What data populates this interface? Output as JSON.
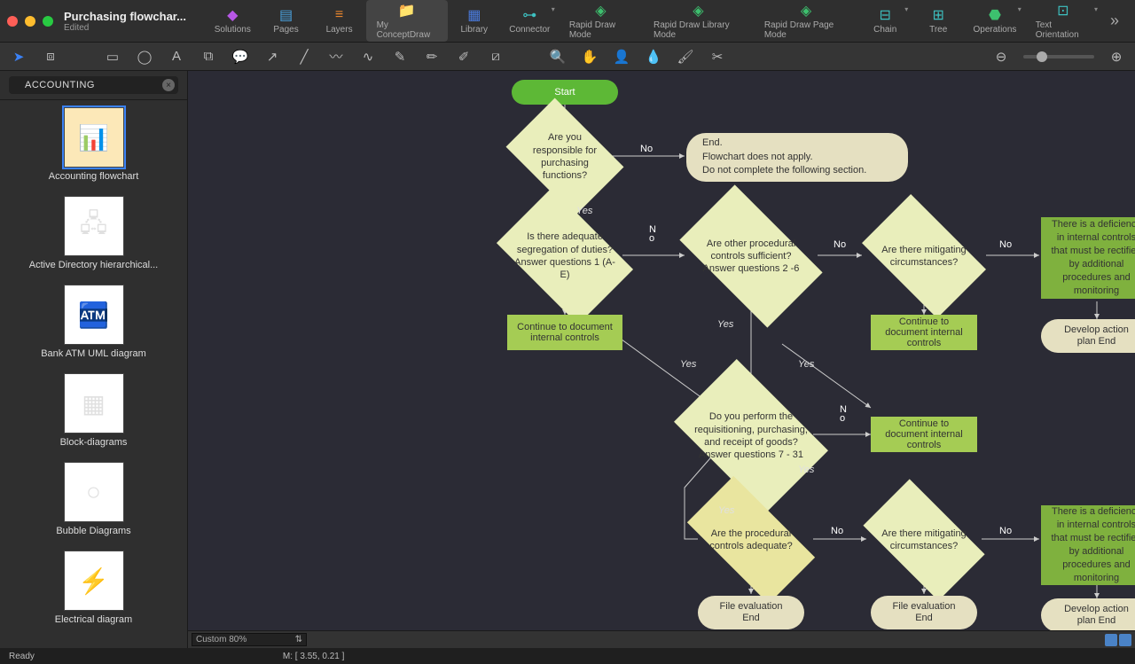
{
  "window": {
    "title": "Purchasing flowchar...",
    "subtitle": "Edited"
  },
  "toolbar": {
    "items": [
      {
        "label": "Solutions",
        "icon": "◆",
        "color": "#b757e6"
      },
      {
        "label": "Pages",
        "icon": "▤",
        "color": "#4aa3e0"
      },
      {
        "label": "Layers",
        "icon": "≡",
        "color": "#e6842e"
      },
      {
        "label": "My ConceptDraw",
        "icon": "📁",
        "color": "#e04a4a",
        "active": true
      },
      {
        "label": "Library",
        "icon": "▦",
        "color": "#4a7ce0"
      },
      {
        "label": "Connector",
        "icon": "⊶",
        "color": "#3dc0c0",
        "chevron": true
      },
      {
        "label": "Rapid Draw Mode",
        "icon": "◈",
        "color": "#3dc06e"
      },
      {
        "label": "Rapid Draw Library Mode",
        "icon": "◈",
        "color": "#3dc06e"
      },
      {
        "label": "Rapid Draw Page Mode",
        "icon": "◈",
        "color": "#3dc06e"
      },
      {
        "label": "Chain",
        "icon": "⊟",
        "color": "#3dc0c0",
        "chevron": true
      },
      {
        "label": "Tree",
        "icon": "⊞",
        "color": "#3dc0c0"
      },
      {
        "label": "Operations",
        "icon": "⬣",
        "color": "#3dc06e",
        "chevron": true
      },
      {
        "label": "Text Orientation",
        "icon": "⊡",
        "color": "#3dc0c0",
        "chevron": true
      }
    ]
  },
  "toolstrip": {
    "tools_left": [
      "pointer",
      "crop-sel"
    ],
    "tools_shapes": [
      "rect",
      "ellipse",
      "text",
      "box",
      "callout",
      "arrow",
      "line",
      "curve",
      "scribble",
      "pen",
      "pen2",
      "pen3",
      "convert"
    ],
    "tools_view": [
      "zoom",
      "hand",
      "person",
      "eyedrop",
      "brush",
      "crop"
    ],
    "tools_zoom": [
      "zoom-out",
      "zoom-in"
    ]
  },
  "sidebar": {
    "search_value": "ACCOUNTING",
    "items": [
      {
        "label": "Accounting flowchart",
        "selected": true
      },
      {
        "label": "Active Directory hierarchical..."
      },
      {
        "label": "Bank ATM UML diagram"
      },
      {
        "label": "Block-diagrams"
      },
      {
        "label": "Bubble Diagrams"
      },
      {
        "label": "Electrical diagram"
      }
    ]
  },
  "flowchart": {
    "start": "Start",
    "d1": "Are you responsible for purchasing functions?",
    "t_end1": "End.\nFlowchart does not apply.\nDo not complete the following section.",
    "d2": "Is there adequate segregation of duties? Answer questions 1 (A-E)",
    "d3": "Are other procedural controls sufficient? Answer questions 2 -6",
    "d4": "Are there mitigating circumstances?",
    "p_def1": "There is a deficiency in internal controls that must be rectified by additional procedures and monitoring",
    "p_cont1": "Continue to document internal controls",
    "p_cont2": "Continue to document internal controls",
    "t_dev1": "Develop action plan End",
    "d5": "Do you perform the requisitioning, purchasing, and receipt of goods? Answer questions 7 - 31",
    "p_cont3": "Continue to document internal controls",
    "d6": "Are the procedural controls adequate?",
    "d7": "Are there mitigating circumstances?",
    "p_def2": "There is a deficiency in internal controls that must be rectified by additional procedures and monitoring",
    "t_file1": "File evaluation End",
    "t_file2": "File evaluation End",
    "t_dev2": "Develop action plan End",
    "labels": {
      "no": "No",
      "yes": "Yes",
      "n_o": "N\no"
    }
  },
  "bottombar": {
    "zoom": "Custom 80%"
  },
  "statusbar": {
    "ready": "Ready",
    "measure": "M: [ 3.55, 0.21 ]"
  }
}
